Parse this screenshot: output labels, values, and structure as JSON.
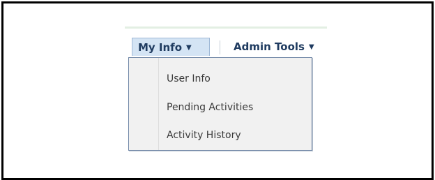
{
  "menubar": {
    "items": [
      {
        "label": "My Info",
        "caret": "▼",
        "active": true
      },
      {
        "label": "Admin Tools",
        "caret": "▼",
        "active": false
      }
    ]
  },
  "dropdown": {
    "items": [
      {
        "label": "User Info"
      },
      {
        "label": "Pending Activities"
      },
      {
        "label": "Activity History"
      }
    ]
  },
  "colors": {
    "menu_text": "#1f3b60",
    "active_bg": "#d4e4f4",
    "dropdown_bg": "#f1f1f1",
    "dropdown_border": "#6f86a6",
    "frame_border": "#000000"
  }
}
